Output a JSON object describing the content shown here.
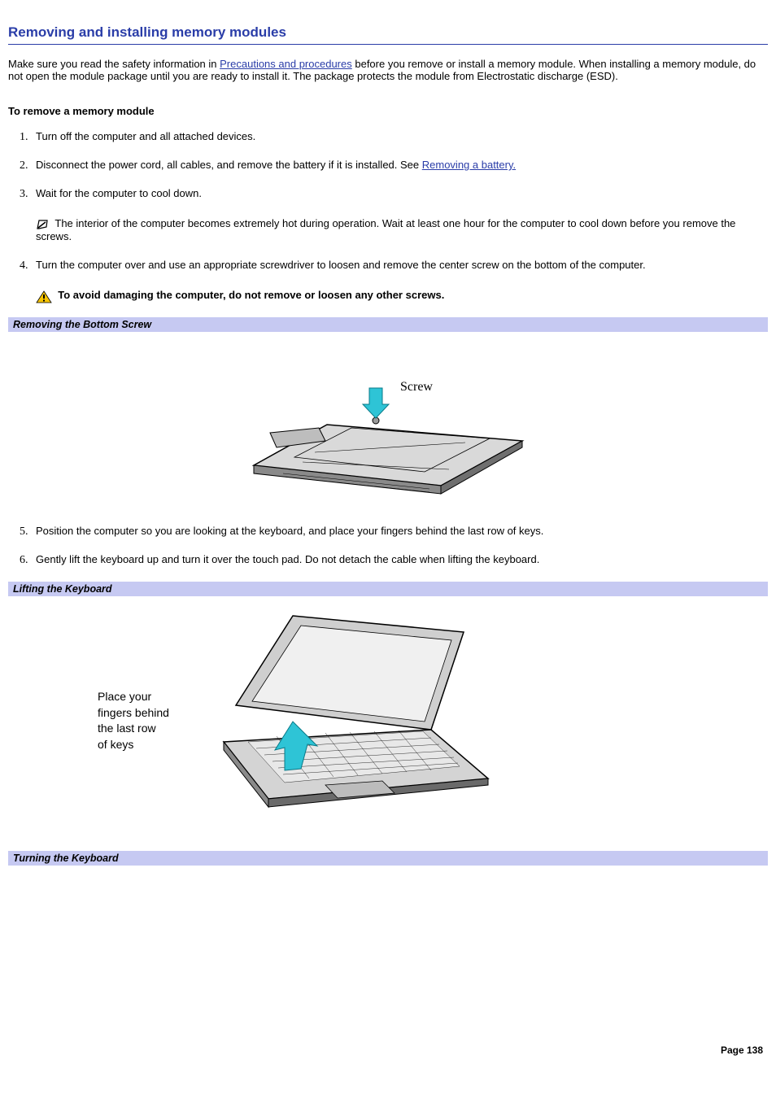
{
  "title": "Removing and installing memory modules",
  "intro_a": "Make sure you read the safety information in ",
  "intro_link1": "Precautions and procedures",
  "intro_b": " before you remove or install a memory module. When installing a memory module, do not open the module package until you are ready to install it. The package protects the module from Electrostatic discharge (ESD).",
  "subhead": "To remove a memory module",
  "step1": "Turn off the computer and all attached devices.",
  "step2_a": "Disconnect the power cord, all cables, and remove the battery if it is installed. See ",
  "step2_link": "Removing a battery.",
  "step3": "Wait for the computer to cool down.",
  "step3_note": "The interior of the computer becomes extremely hot during operation. Wait at least one hour for the computer to cool down before you remove the screws.",
  "step4": "Turn the computer over and use an appropriate screwdriver to loosen and remove the center screw on the bottom of the computer.",
  "step4_warn": "To avoid damaging the computer, do not remove or loosen any other screws.",
  "fig1_caption": "Removing the Bottom Screw",
  "fig1_label_screw": "Screw",
  "step5": "Position the computer so you are looking at the keyboard, and place your fingers behind the last row of keys.",
  "step6": "Gently lift the keyboard up and turn it over the touch pad. Do not detach the cable when lifting the keyboard.",
  "fig2_caption": "Lifting the Keyboard",
  "fig2_label": "Place your\nfingers behind\nthe last row\nof keys",
  "fig3_caption": "Turning the Keyboard",
  "page_footer": "Page 138"
}
